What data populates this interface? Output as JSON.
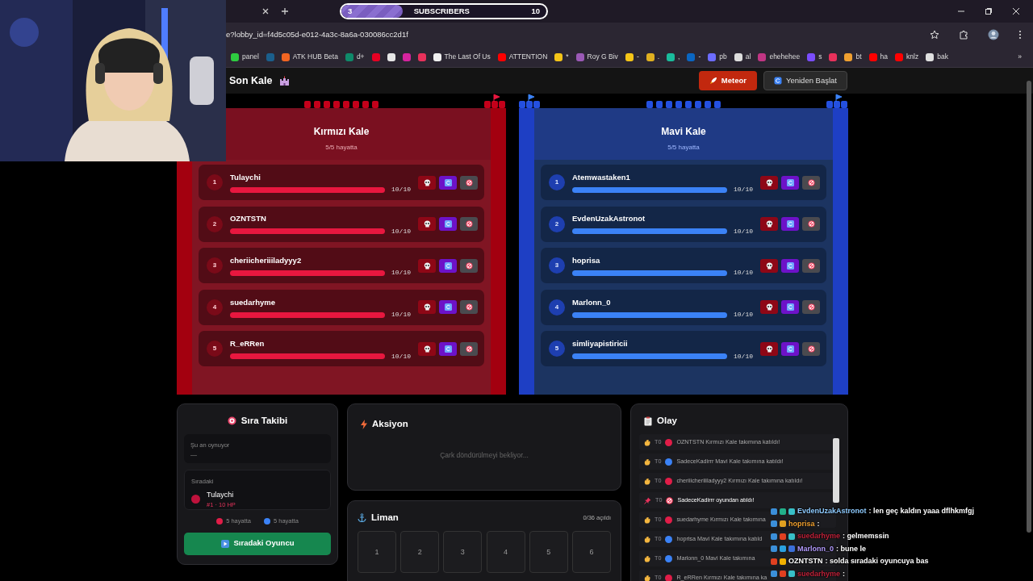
{
  "stream_overlay": {
    "sub_goal": {
      "current": "3",
      "label": "SUBSCRIBERS",
      "target": "10",
      "level": 0.3
    }
  },
  "browser": {
    "url": "e?lobby_id=f4d5c05d-e012-4a3c-8a6a-030086cc2d1f",
    "bookmarks": [
      {
        "label": "panel",
        "color": "#2ecc40"
      },
      {
        "color": "#1b5f8c"
      },
      {
        "label": "ATK HUB Beta",
        "color": "#f26522"
      },
      {
        "label": "d+",
        "color": "#0f8a6a"
      },
      {
        "color": "#e60023"
      },
      {
        "color": "#e6e6e6"
      },
      {
        "color": "#d6249f"
      },
      {
        "color": "#e8315b"
      },
      {
        "label": "The Last Of Us",
        "color": "#f0f0f0"
      },
      {
        "label": "ATTENTION",
        "color": "#ff0000"
      },
      {
        "label": "*",
        "color": "#f5c518"
      },
      {
        "label": "Roy G Biv",
        "color": "#9b59b6"
      },
      {
        "label": "-",
        "color": "#f5c518"
      },
      {
        "label": ".",
        "color": "#e0b020"
      },
      {
        "label": ",",
        "color": "#1abc9c"
      },
      {
        "label": "-",
        "color": "#0a66c2"
      },
      {
        "label": "pb",
        "color": "#6c6cff"
      },
      {
        "label": "al",
        "color": "#dddddd"
      },
      {
        "label": "ehehehee",
        "color": "#c13584"
      },
      {
        "label": "s",
        "color": "#7b4dff"
      },
      {
        "color": "#e8315b"
      },
      {
        "label": "bt",
        "color": "#f0a030"
      },
      {
        "label": "ha",
        "color": "#ff0000"
      },
      {
        "label": "knlz",
        "color": "#ff0000"
      },
      {
        "label": "bak",
        "color": "#e0e0e0"
      }
    ],
    "more": "»"
  },
  "app": {
    "title": "Son Kale",
    "buttons": [
      {
        "label": "Meteor",
        "kind": "meteor"
      },
      {
        "label": "Yeniden Başlat",
        "kind": "restart"
      }
    ]
  },
  "castles": [
    {
      "kind": "red",
      "name": "Kırmızı Kale",
      "status": "5/5 hayatta",
      "players": [
        {
          "rank": "1",
          "name": "Tulaychi",
          "level": 1,
          "hp": "10/10"
        },
        {
          "rank": "2",
          "name": "OZNTSTN",
          "level": 1,
          "hp": "10/10"
        },
        {
          "rank": "3",
          "name": "cheriicheriiiladyyy2",
          "level": 1,
          "hp": "10/10"
        },
        {
          "rank": "4",
          "name": "suedarhyme",
          "level": 1,
          "hp": "10/10"
        },
        {
          "rank": "5",
          "name": "R_eRRen",
          "level": 1,
          "hp": "10/10"
        }
      ]
    },
    {
      "kind": "blue",
      "name": "Mavi Kale",
      "status": "5/5 hayatta",
      "players": [
        {
          "rank": "1",
          "name": "Atemwastaken1",
          "level": 1,
          "hp": "10/10"
        },
        {
          "rank": "2",
          "name": "EvdenUzakAstronot",
          "level": 1,
          "hp": "10/10"
        },
        {
          "rank": "3",
          "name": "hoprisa",
          "level": 1,
          "hp": "10/10"
        },
        {
          "rank": "4",
          "name": "Marlonn_0",
          "level": 1,
          "hp": "10/10"
        },
        {
          "rank": "5",
          "name": "simliyapistiricii",
          "level": 1,
          "hp": "10/10"
        }
      ]
    }
  ],
  "turn_tracker": {
    "title": "Sıra Takibi",
    "current_label": "Şu an oynuyor",
    "current_value": "—",
    "next_label": "Sıradaki",
    "next": {
      "name": "Tulaychi",
      "detail": "#1 · 10 HP",
      "color": "#be123c"
    },
    "counts": [
      {
        "color": "#e11d48",
        "text": "5 hayatta"
      },
      {
        "color": "#3b82f6",
        "text": "5 hayatta"
      }
    ],
    "button": "Sıradaki Oyuncu"
  },
  "action": {
    "title": "Aksiyon",
    "waiting": "Çark döndürülmeyi bekliyor..."
  },
  "harbor": {
    "title": "Liman",
    "progress": "0/36 açıldı",
    "cells": [
      "1",
      "2",
      "3",
      "4",
      "5",
      "6"
    ]
  },
  "event_log": {
    "title": "Olay",
    "events": [
      {
        "kind": "join",
        "turn": "T0",
        "color": "#e11d48",
        "text": "OZNTSTN Kırmızı Kale takımına katıldı!"
      },
      {
        "kind": "join",
        "turn": "T0",
        "color": "#3b82f6",
        "text": "SadeceKadirrr Mavi Kale takımına katıldı!"
      },
      {
        "kind": "join",
        "turn": "T0",
        "color": "#e11d48",
        "text": "cheriiicheriiiladyyy2 Kırmızı Kale takımına katıldı!"
      },
      {
        "kind": "kick",
        "turn": "T0",
        "text": "SadeceKadirrr oyundan atıldı!"
      },
      {
        "kind": "join",
        "turn": "T0",
        "color": "#e11d48",
        "text": "suedarhyme Kırmızı Kale takımına"
      },
      {
        "kind": "join",
        "turn": "T0",
        "color": "#3b82f6",
        "text": "hoprisa Mavi Kale takımına katıld"
      },
      {
        "kind": "join",
        "turn": "T0",
        "color": "#3b82f6",
        "text": "Marlonn_0 Mavi Kale takımına"
      },
      {
        "kind": "join",
        "turn": "T0",
        "color": "#e11d48",
        "text": "R_eRRen Kırmızı Kale takımına ka"
      }
    ]
  },
  "chat": [
    {
      "user": "EvdenUzakAstronot",
      "color": "#8ecbff",
      "message": ": len geç kaldın yaaa dflhkmfgj",
      "badges": [
        {
          "color": "#3b8fd9"
        },
        {
          "color": "#22b08a"
        },
        {
          "color": "#38c0c8"
        }
      ]
    },
    {
      "user": "hoprisa",
      "color": "#f0a030",
      "message": ":",
      "badges": [
        {
          "color": "#3b8fd9"
        },
        {
          "color": "#e0a020"
        }
      ]
    },
    {
      "user": "suedarhyme",
      "color": "#c0223a",
      "message": ": gelmemssin",
      "badges": [
        {
          "color": "#3b8fd9"
        },
        {
          "color": "#e04020"
        },
        {
          "color": "#38c0c8"
        }
      ]
    },
    {
      "user": "Marlonn_0",
      "color": "#b49cff",
      "message": ": bune le",
      "badges": [
        {
          "color": "#3b8fd9"
        },
        {
          "color": "#2aa0e0"
        },
        {
          "color": "#3b6fd9"
        }
      ]
    },
    {
      "user": "OZNTSTN",
      "color": "#ffffff",
      "message": ": solda sıradaki oyuncuya bas",
      "badges": [
        {
          "color": "#e04020"
        },
        {
          "color": "#f0b000"
        }
      ]
    },
    {
      "user": "suedarhyme",
      "color": "#c0223a",
      "message": ":",
      "badges": [
        {
          "color": "#3b8fd9"
        },
        {
          "color": "#e04020"
        },
        {
          "color": "#38c0c8"
        }
      ]
    }
  ]
}
